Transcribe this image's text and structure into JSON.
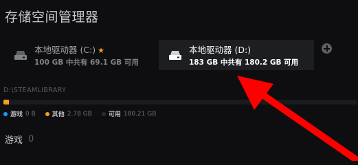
{
  "page": {
    "title": "存储空间管理器"
  },
  "drives": [
    {
      "name": "本地驱动器 (C:)",
      "size_text": "100 GB 中共有 69.1 GB 可用",
      "favorite": true,
      "icon": "drive-icon"
    },
    {
      "name": "本地驱动器 (D:)",
      "size_text": "183 GB 中共有 180.2 GB 可用",
      "selected": true,
      "icon": "drive-icon"
    }
  ],
  "add_button": {
    "icon": "plus-circle-icon"
  },
  "library": {
    "path": "D:\\STEAMLIBRARY",
    "usage": {
      "games_fraction": 0.0,
      "other_fraction": 0.015,
      "total_gb": 183
    },
    "legend": [
      {
        "label": "游戏",
        "value": "0 B",
        "color": "#1a9fff"
      },
      {
        "label": "其他",
        "value": "2.78 GB",
        "color": "#f0a020"
      },
      {
        "label": "可用",
        "value": "180.21 GB",
        "color": "#2a2c30"
      }
    ]
  },
  "games": {
    "label": "游戏",
    "count": "0"
  },
  "colors": {
    "accent_other": "#f0a020",
    "accent_games": "#1a9fff",
    "star": "#f0a226",
    "annotation_arrow": "#ff0000"
  }
}
